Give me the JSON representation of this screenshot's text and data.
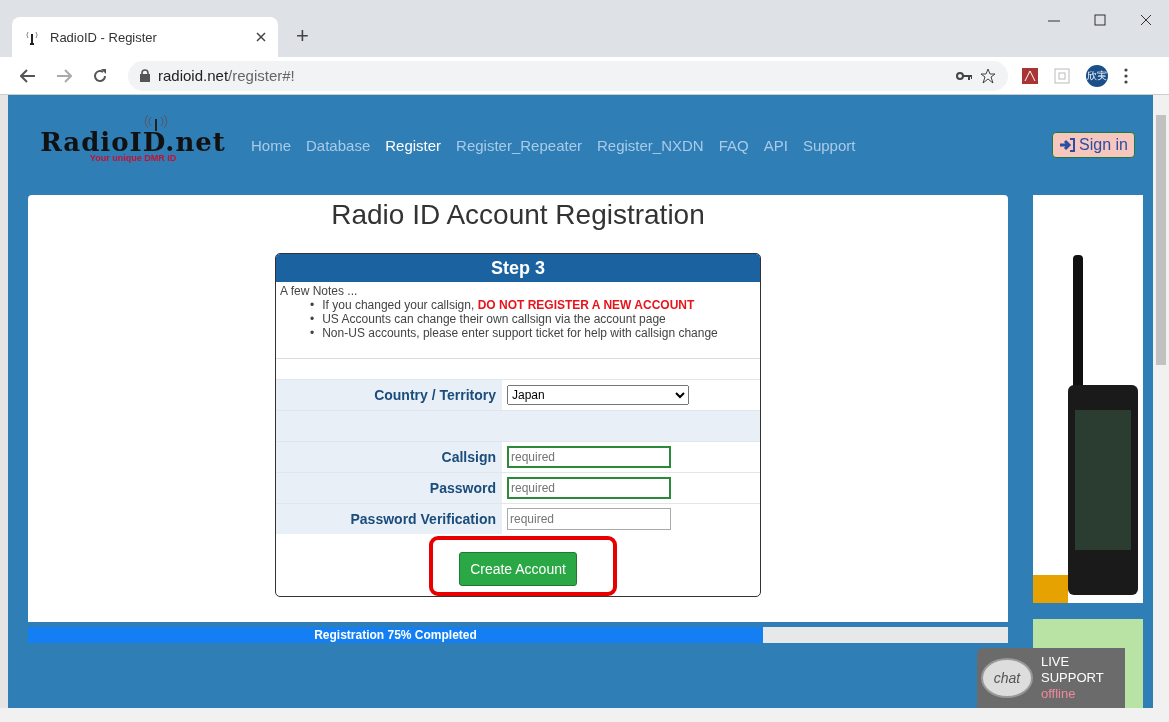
{
  "browser": {
    "tab_title": "RadioID - Register",
    "url_host": "radioid.net",
    "url_path": "/register#!",
    "new_tab": "+",
    "profile": "欣実"
  },
  "site": {
    "logo": "RadioID.net",
    "tagline": "Your unique DMR ID",
    "nav": [
      {
        "label": "Home",
        "selected": false
      },
      {
        "label": "Database",
        "selected": false
      },
      {
        "label": "Register",
        "selected": true
      },
      {
        "label": "Register_Repeater",
        "selected": false
      },
      {
        "label": "Register_NXDN",
        "selected": false
      },
      {
        "label": "FAQ",
        "selected": false
      },
      {
        "label": "API",
        "selected": false
      },
      {
        "label": "Support",
        "selected": false
      }
    ],
    "sign_in": "Sign in"
  },
  "page_title": "Radio ID Account Registration",
  "step": {
    "title": "Step 3",
    "notes_intro": "A few Notes ...",
    "notes": [
      {
        "bullet": "•",
        "text": "If you changed your callsign, ",
        "warning": "DO NOT REGISTER A NEW ACCOUNT"
      },
      {
        "bullet": "•",
        "text": "US Accounts can change their own callsign via the account page"
      },
      {
        "bullet": "•",
        "text": "Non-US accounts, please enter support ticket for help with callsign change"
      }
    ],
    "fields": [
      {
        "kind": "select",
        "label": "Country / Territory",
        "value": "Japan"
      },
      {
        "kind": "blank"
      },
      {
        "kind": "input",
        "label": "Callsign",
        "placeholder": "required",
        "valid": true
      },
      {
        "kind": "input",
        "label": "Password",
        "placeholder": "required",
        "valid": true
      },
      {
        "kind": "input",
        "label": "Password Verification",
        "placeholder": "required",
        "valid": false
      }
    ],
    "submit": "Create Account"
  },
  "progress": {
    "label": "Registration 75% Completed",
    "level": 0.75
  },
  "chat_widget": {
    "bubble": "chat",
    "line_1": "LIVE",
    "line_2": "SUPPORT",
    "status": "offline"
  }
}
